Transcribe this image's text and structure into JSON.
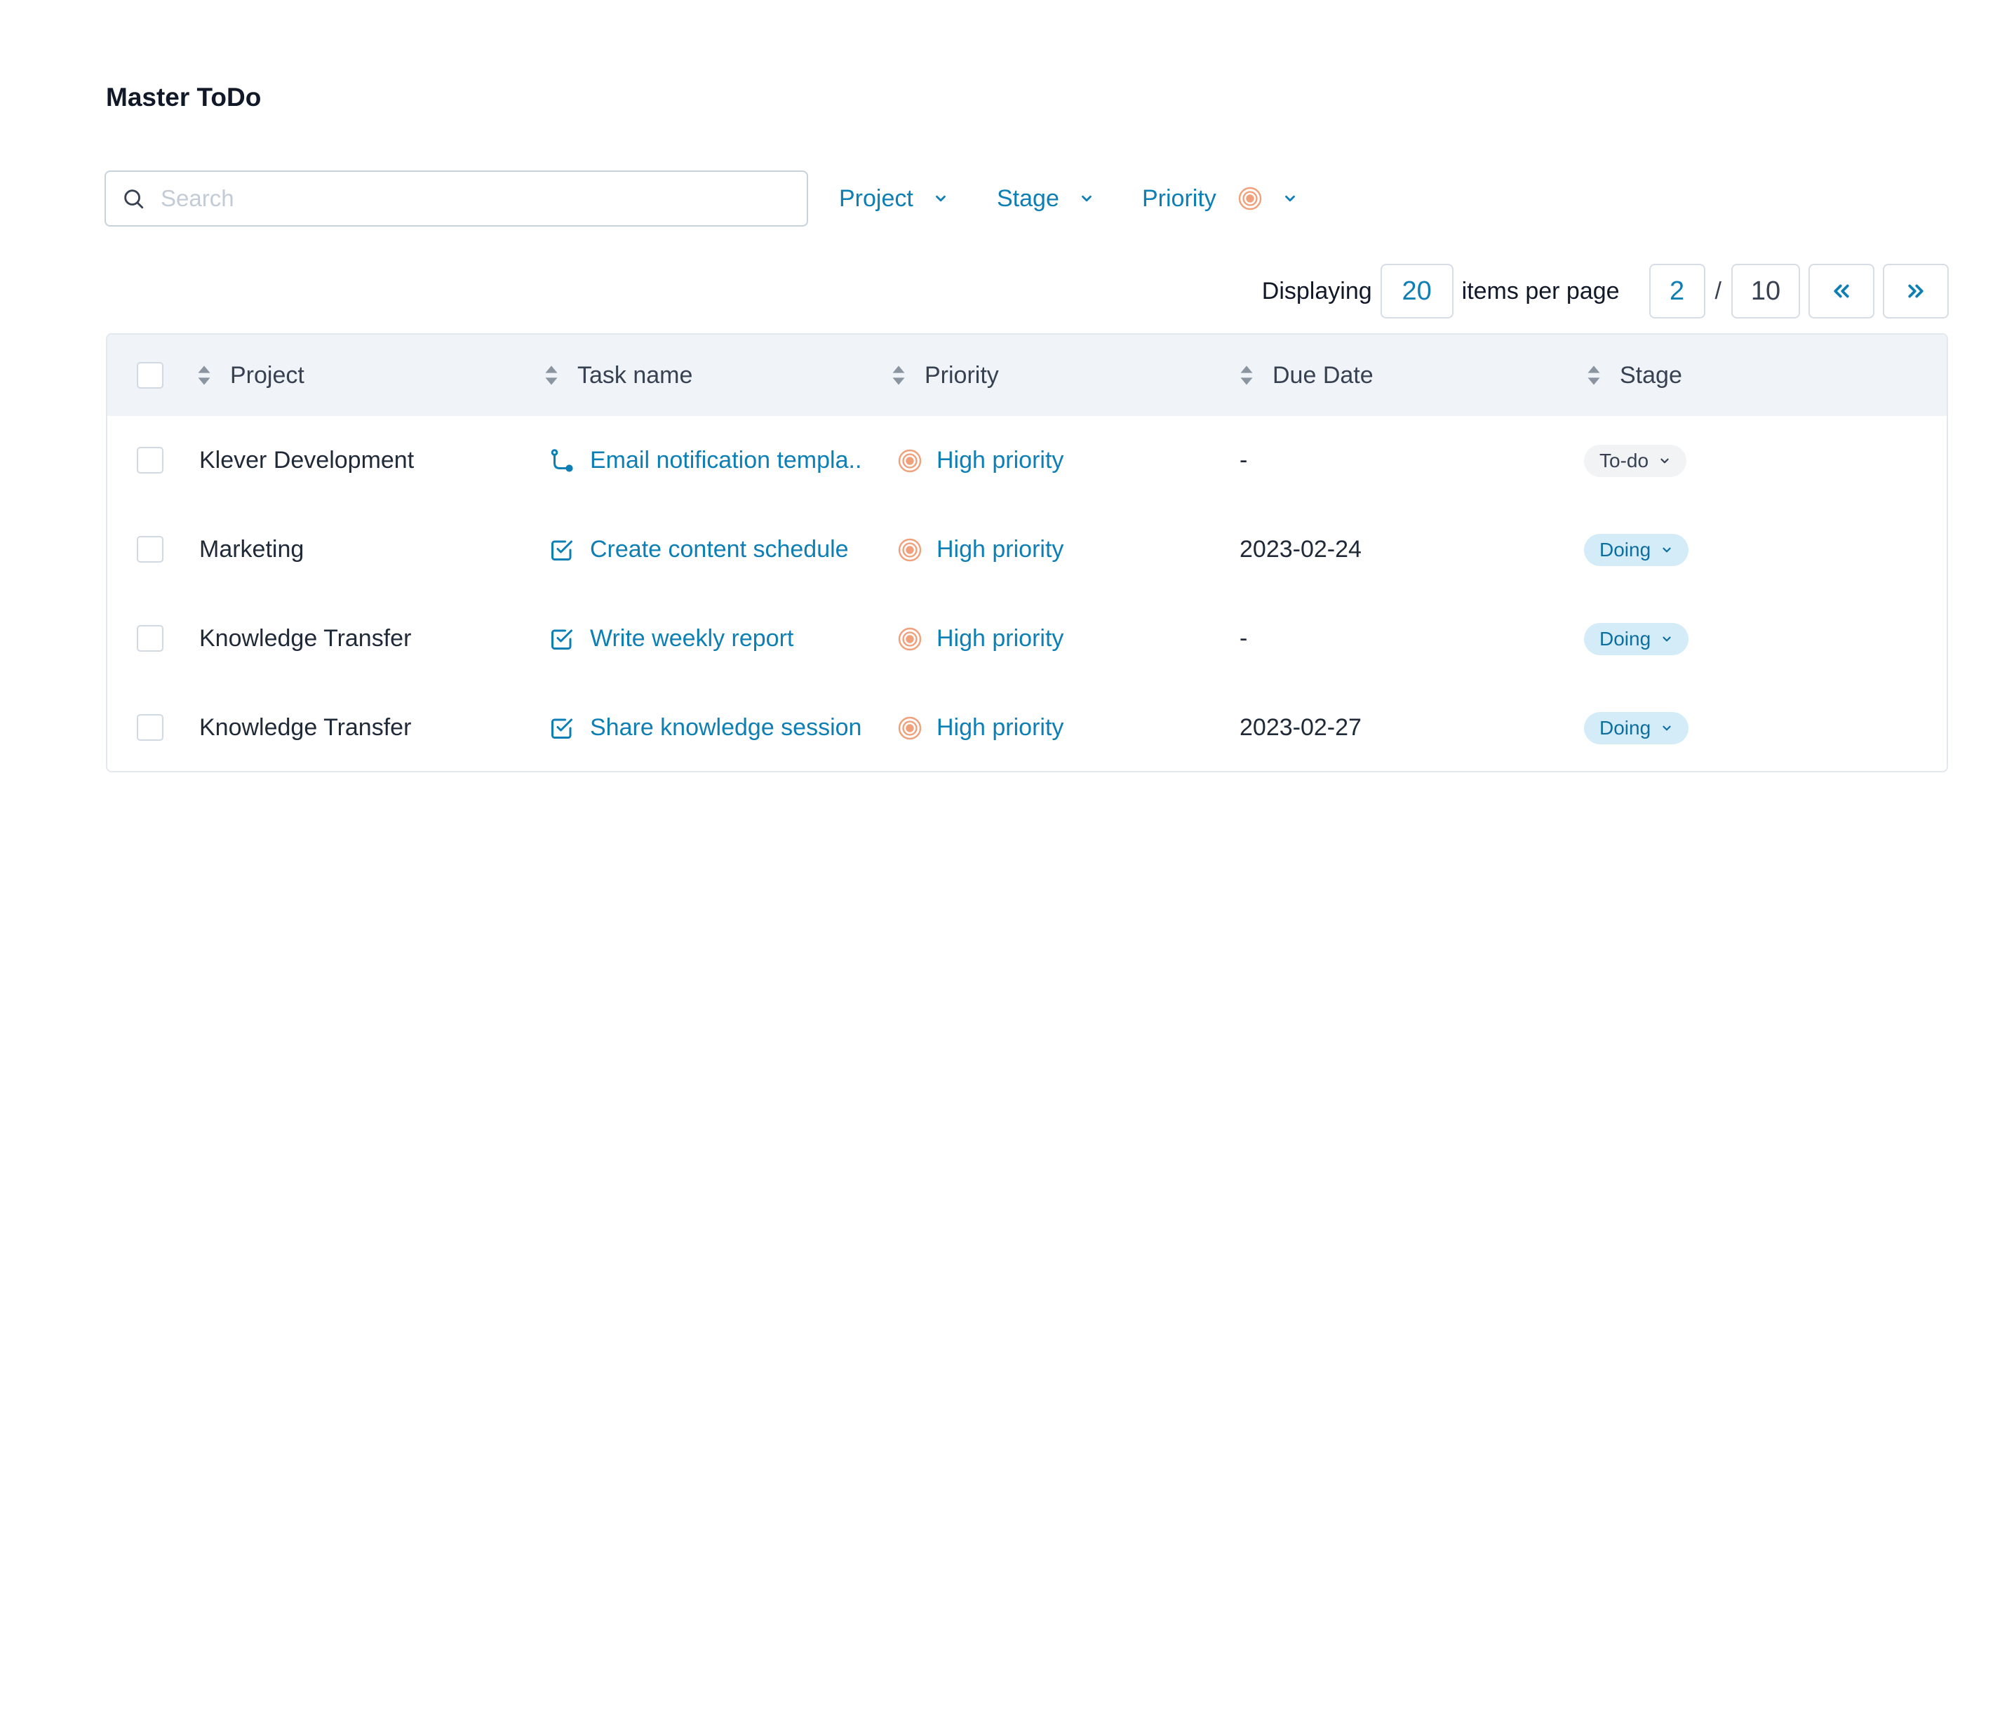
{
  "page": {
    "title": "Master ToDo"
  },
  "search": {
    "placeholder": "Search",
    "value": ""
  },
  "filters": {
    "project": "Project",
    "stage": "Stage",
    "priority": "Priority"
  },
  "pagination": {
    "displaying_label": "Displaying",
    "per_page": "20",
    "per_page_label": "items per page",
    "current_page": "2",
    "separator": "/",
    "total_pages": "10",
    "prev_icon": "«",
    "next_icon": "»"
  },
  "table": {
    "headers": {
      "project": "Project",
      "task": "Task name",
      "priority": "Priority",
      "due": "Due Date",
      "stage": "Stage"
    },
    "rows": [
      {
        "project": "Klever Development",
        "task": "Email notification templa..",
        "task_icon": "subtask-icon",
        "priority": "High priority",
        "due": "-",
        "stage": "To-do"
      },
      {
        "project": "Marketing",
        "task": "Create content schedule",
        "task_icon": "checkbox-task-icon",
        "priority": "High priority",
        "due": "2023-02-24",
        "stage": "Doing"
      },
      {
        "project": "Knowledge Transfer",
        "task": "Write weekly report",
        "task_icon": "checkbox-task-icon",
        "priority": "High priority",
        "due": "-",
        "stage": "Doing"
      },
      {
        "project": "Knowledge Transfer",
        "task": "Share knowledge session",
        "task_icon": "checkbox-task-icon",
        "priority": "High priority",
        "due": "2023-02-27",
        "stage": "Doing"
      }
    ]
  },
  "colors": {
    "accent": "#0d7fb5",
    "priority_high": "#f0a07a",
    "header_bg": "#f0f4f8",
    "doing_bg": "#d4ecf8",
    "todo_bg": "#f1f3f5"
  }
}
